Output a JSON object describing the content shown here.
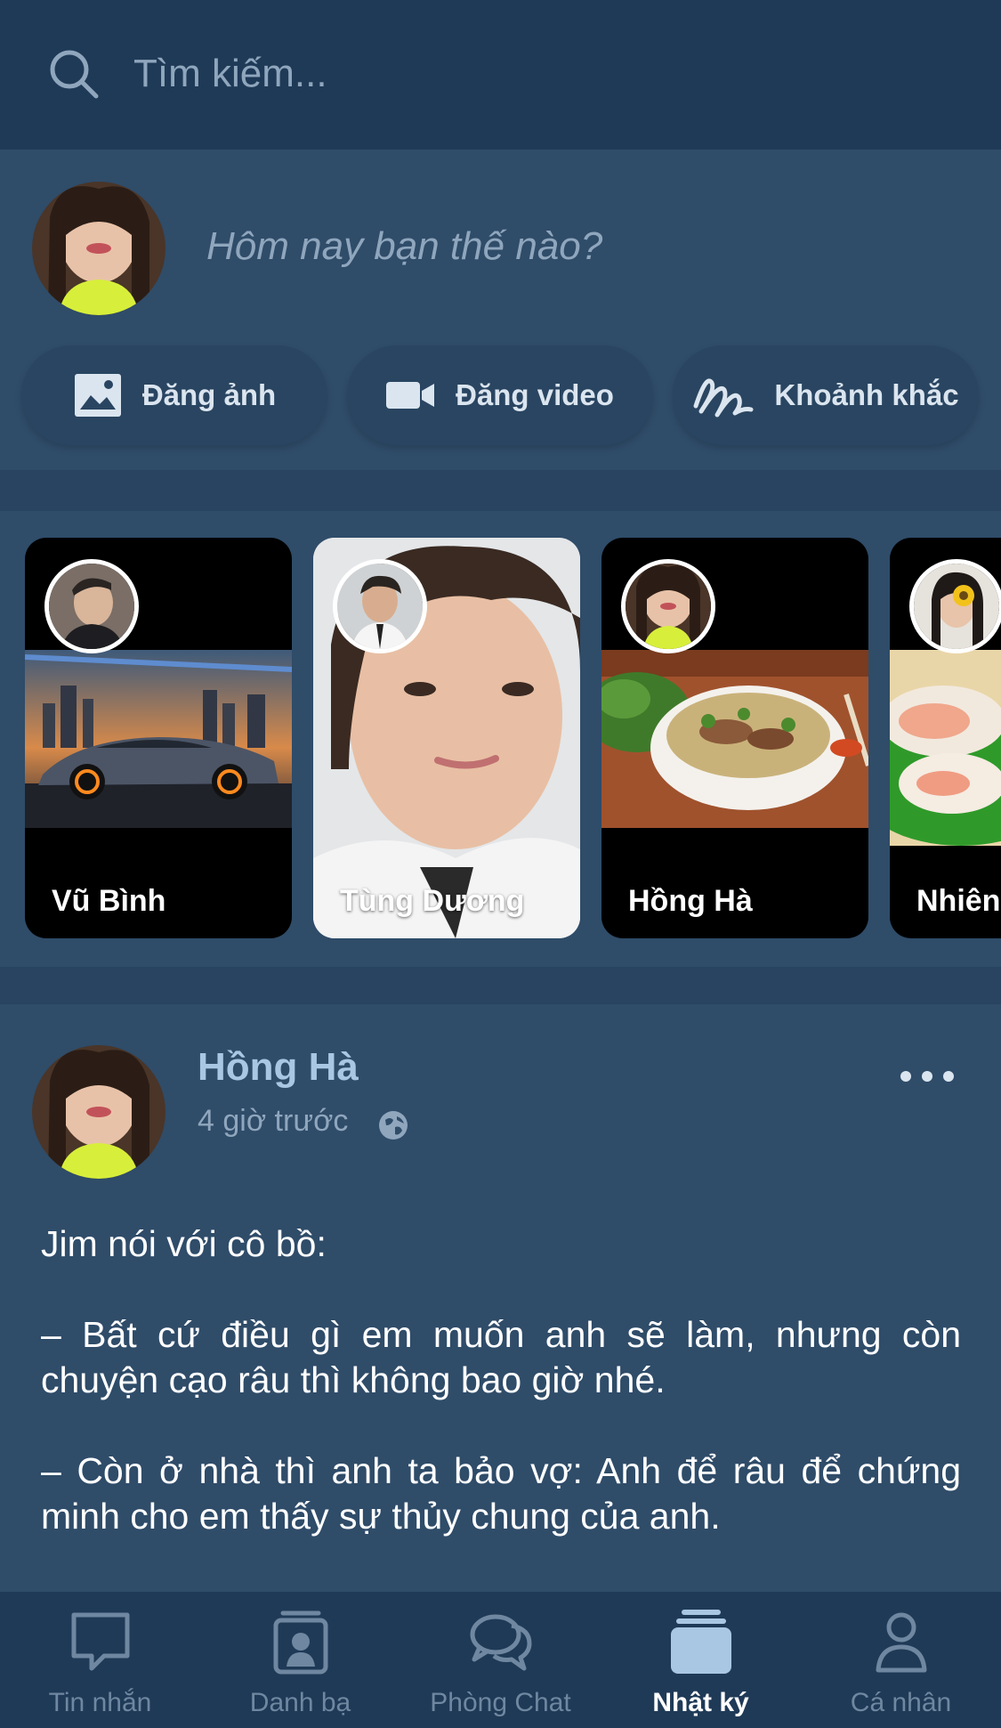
{
  "search": {
    "placeholder": "Tìm kiếm..."
  },
  "composer": {
    "prompt": "Hôm nay bạn thế nào?",
    "buttons": [
      {
        "label": "Đăng ảnh",
        "icon": "image-icon"
      },
      {
        "label": "Đăng video",
        "icon": "video-icon"
      },
      {
        "label": "Khoảnh khắc",
        "icon": "scribble-icon"
      }
    ]
  },
  "stories": [
    {
      "name": "Vũ Bình"
    },
    {
      "name": "Tùng Dương"
    },
    {
      "name": "Hồng Hà"
    },
    {
      "name": "Nhiên"
    }
  ],
  "post": {
    "author": "Hồng Hà",
    "time": "4 giờ trước",
    "paragraphs": [
      "Jim nói với cô bồ:",
      "– Bất cứ điều gì em muốn anh sẽ làm, nhưng còn chuyện cạo râu thì không bao giờ nhé.",
      "– Còn ở nhà thì anh ta bảo vợ: Anh để râu để chứng minh cho em thấy sự thủy chung của anh."
    ]
  },
  "tabs": [
    {
      "label": "Tin nhắn",
      "icon": "message-icon",
      "active": false
    },
    {
      "label": "Danh bạ",
      "icon": "contacts-icon",
      "active": false
    },
    {
      "label": "Phòng Chat",
      "icon": "chat-room-icon",
      "active": false
    },
    {
      "label": "Nhật ký",
      "icon": "timeline-icon",
      "active": true
    },
    {
      "label": "Cá nhân",
      "icon": "profile-icon",
      "active": false
    }
  ],
  "colors": {
    "background": "#2e4a66",
    "header": "#1f3a57",
    "accent_text": "#a9c6e2",
    "muted_text": "#8fa6bd"
  }
}
